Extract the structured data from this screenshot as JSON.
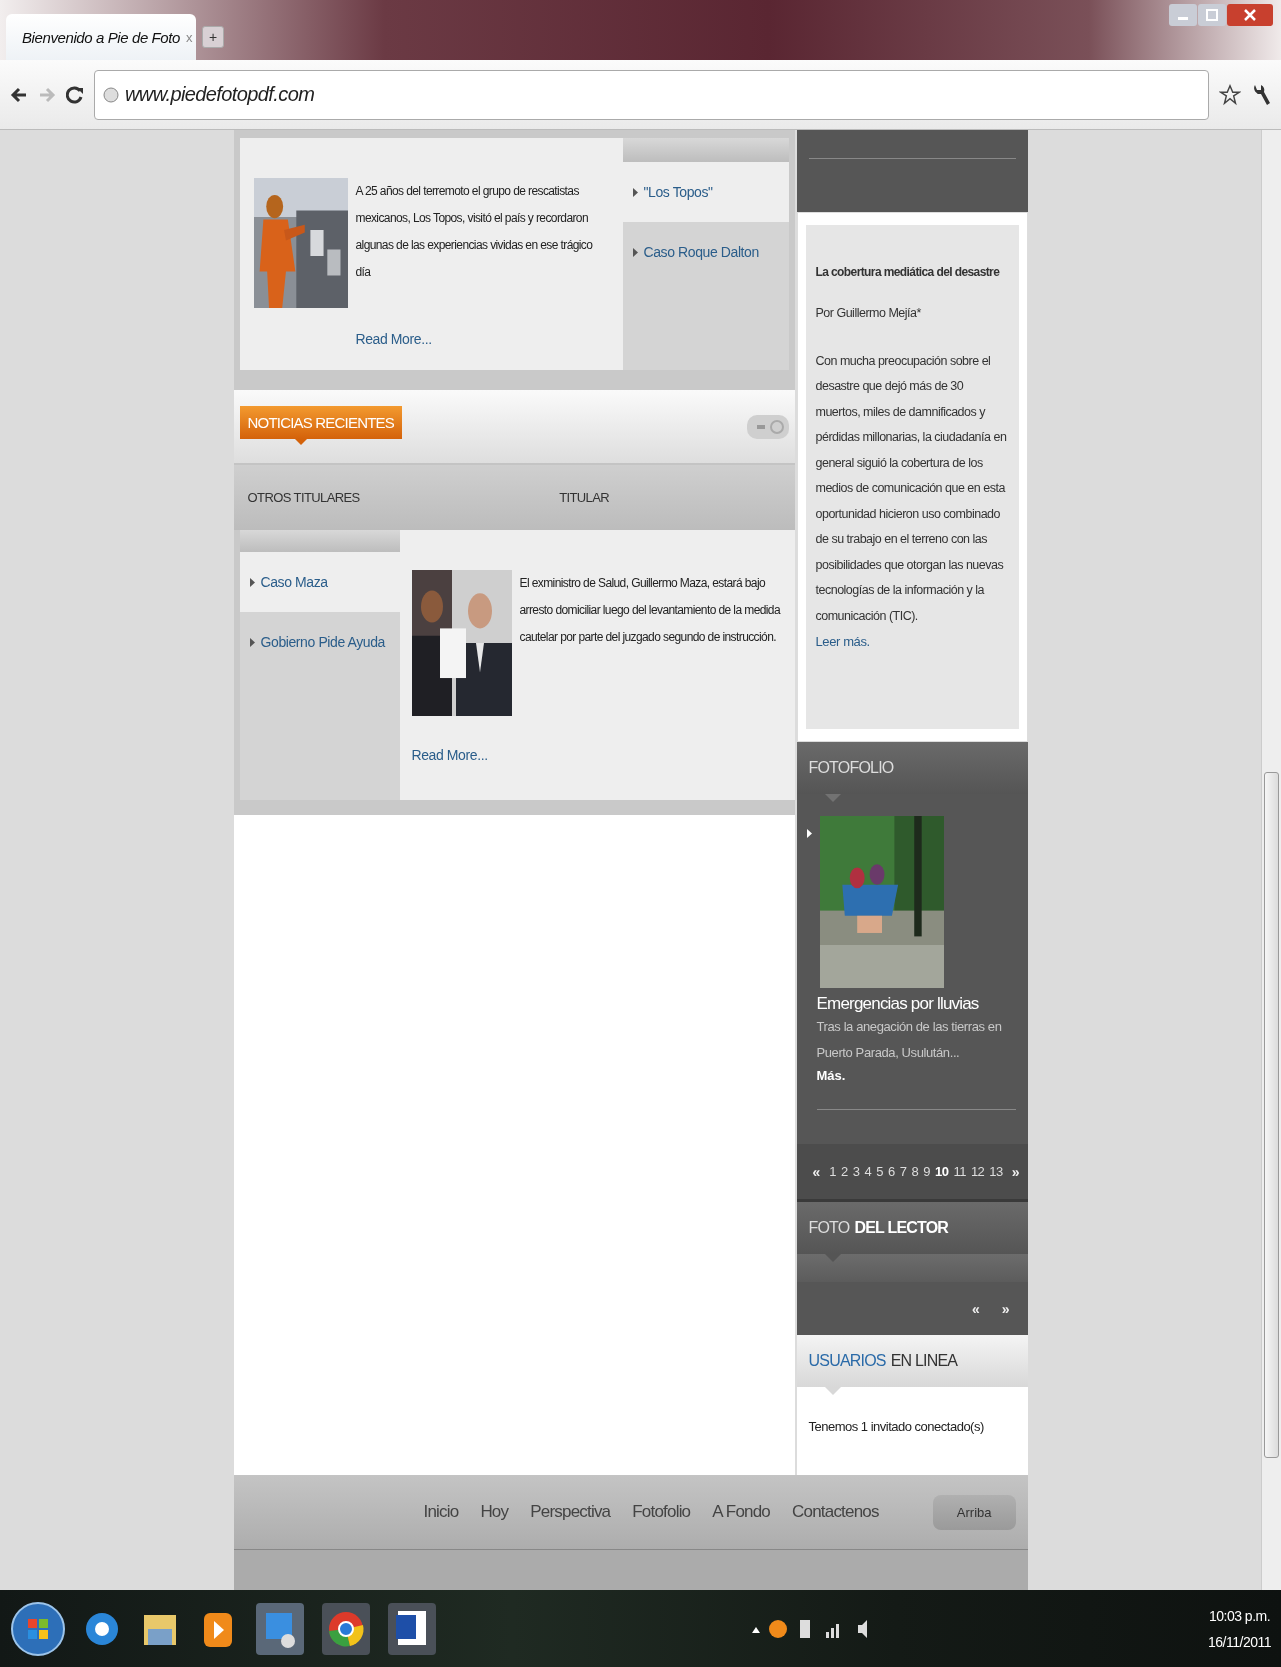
{
  "browser": {
    "tab_title": "Bienvenido a Pie de Foto",
    "tab_close": "x",
    "new_tab": "+",
    "address": "www.piedefotopdf.com"
  },
  "featured": {
    "text": "A 25 años del terremoto el grupo de rescatistas mexicanos, Los Topos, visitó el país y recordaron algunas de las experiencias vividas en ese trágico día",
    "read_more": "Read More...",
    "links": [
      {
        "label": "\"Los Topos\"",
        "selected": true
      },
      {
        "label": "Caso Roque Dalton",
        "selected": false
      }
    ]
  },
  "recent": {
    "title": "NOTICIAS RECIENTES",
    "columns": [
      "OTROS TITULARES",
      "TITULAR"
    ],
    "links": [
      {
        "label": "Caso Maza",
        "selected": true
      },
      {
        "label": "Gobierno Pide Ayuda",
        "selected": false
      }
    ],
    "text": "El exministro de Salud, Guillermo Maza, estará bajo arresto domiciliar luego del levantamiento de la medida cautelar por parte del juzgado segundo de instrucción.",
    "read_more": "Read More..."
  },
  "opinion": {
    "title": "La cobertura mediática del desastre",
    "byline": "Por Guillermo Mejía*",
    "body": "Con mucha preocupación sobre el desastre que dejó más de 30 muertos, miles de damnificados y pérdidas millonarias, la ciudadanía en general siguió la cobertura de los medios de comunicación que en esta oportunidad hicieron uso combinado de su trabajo en el terreno con las posibilidades que otorgan las nuevas tecnologías de la información y la comunicación (TIC).",
    "link": "Leer más."
  },
  "fotofolio": {
    "title": "FOTOFOLIO",
    "caption": "Emergencias por lluvias",
    "summary": "Tras la anegación de las tierras en Puerto Parada, Usulután...",
    "more": "Más.",
    "prev": "«",
    "next": "»",
    "pages": [
      {
        "label": "1",
        "selected": false
      },
      {
        "label": "2",
        "selected": false
      },
      {
        "label": "3",
        "selected": false
      },
      {
        "label": "4",
        "selected": false
      },
      {
        "label": "5",
        "selected": false
      },
      {
        "label": "6",
        "selected": false
      },
      {
        "label": "7",
        "selected": false
      },
      {
        "label": "8",
        "selected": false
      },
      {
        "label": "9",
        "selected": false
      },
      {
        "label": "10",
        "selected": true
      },
      {
        "label": "11",
        "selected": false
      },
      {
        "label": "12",
        "selected": false
      },
      {
        "label": "13",
        "selected": false
      }
    ]
  },
  "reader_photo": {
    "title_light": "FOTO",
    "title_bold": "DEL LECTOR",
    "prev": "«",
    "next": "»"
  },
  "online": {
    "title_accent": "USUARIOS",
    "title_rest": "EN LINEA",
    "text": "Tenemos 1 invitado conectado(s)"
  },
  "footer": {
    "nav": [
      "Inicio",
      "Hoy",
      "Perspectiva",
      "Fotofolio",
      "A Fondo",
      "Contactenos"
    ],
    "top_button": "Arriba"
  },
  "taskbar": {
    "time": "10:03 p.m.",
    "date": "16/11/2011"
  }
}
